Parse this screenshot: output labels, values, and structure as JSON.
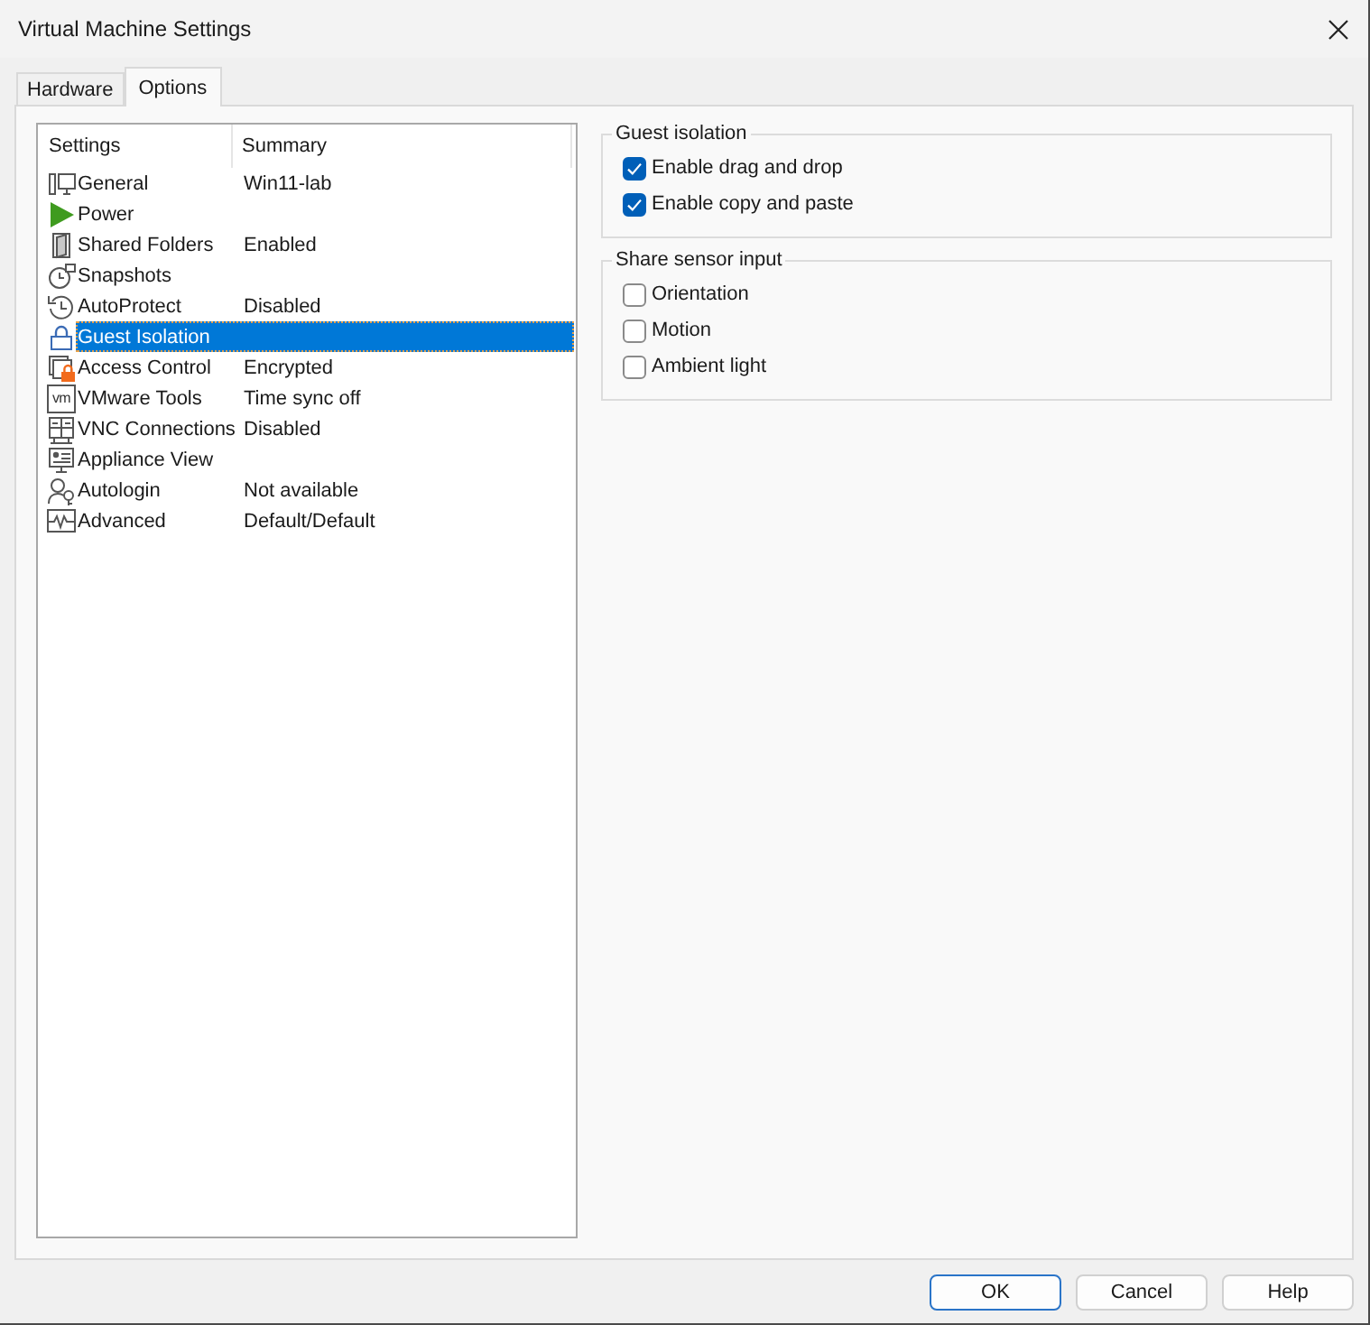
{
  "window": {
    "title": "Virtual Machine Settings"
  },
  "tabs": [
    {
      "label": "Hardware",
      "selected": false
    },
    {
      "label": "Options",
      "selected": true
    }
  ],
  "settings_list": {
    "columns": [
      "Settings",
      "Summary"
    ],
    "rows": [
      {
        "kind": "computer",
        "name": "General",
        "summary": "Win11-lab",
        "selected": false
      },
      {
        "kind": "power",
        "name": "Power",
        "selected": false
      },
      {
        "kind": "shared_folders",
        "name": "Shared Folders",
        "summary": "Enabled",
        "selected": false
      },
      {
        "kind": "snapshots",
        "name": "Snapshots",
        "selected": false
      },
      {
        "kind": "autoprotect",
        "name": "AutoProtect",
        "summary": "Disabled",
        "selected": false
      },
      {
        "kind": "isolation",
        "name": "Guest Isolation",
        "selected": true
      },
      {
        "kind": "access",
        "name": "Access Control",
        "summary": "Encrypted",
        "selected": false
      },
      {
        "kind": "tools",
        "icon_label": "vm",
        "name": "VMware Tools",
        "summary": "Time sync off",
        "selected": false
      },
      {
        "kind": "vnc",
        "name": "VNC Connections",
        "summary": "Disabled",
        "selected": false
      },
      {
        "kind": "appliance",
        "name": "Appliance View",
        "selected": false
      },
      {
        "kind": "autologin",
        "name": "Autologin",
        "summary": "Not available",
        "selected": false
      },
      {
        "kind": "advanced",
        "name": "Advanced",
        "summary": "Default/Default",
        "selected": false
      }
    ]
  },
  "groups": [
    {
      "title": "Guest isolation",
      "options": [
        {
          "label": "Enable drag and drop",
          "checked": true
        },
        {
          "label": "Enable copy and paste",
          "checked": true
        }
      ]
    },
    {
      "title": "Share sensor input",
      "options": [
        {
          "label": "Orientation",
          "checked": false
        },
        {
          "label": "Motion",
          "checked": false
        },
        {
          "label": "Ambient light",
          "checked": false
        }
      ]
    }
  ],
  "buttons": [
    {
      "label": "OK",
      "default": true
    },
    {
      "label": "Cancel",
      "default": false
    },
    {
      "label": "Help",
      "default": false
    }
  ]
}
